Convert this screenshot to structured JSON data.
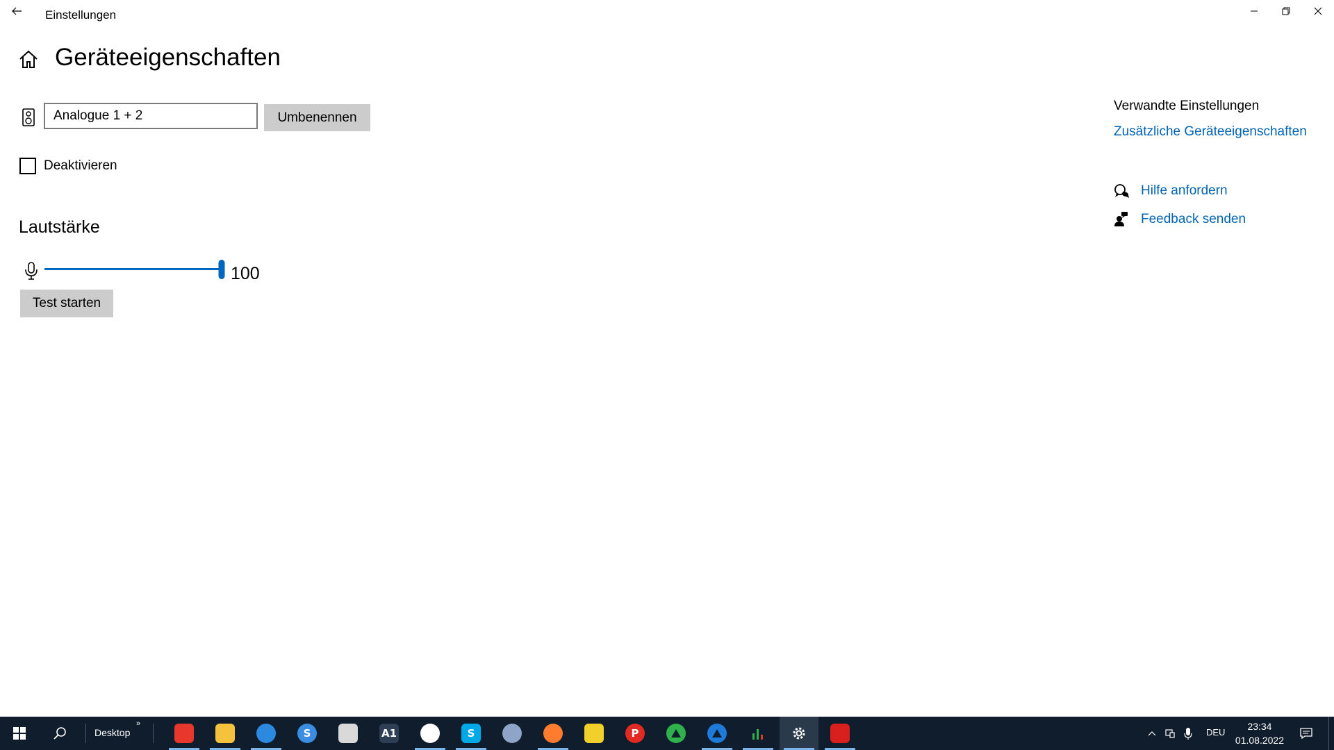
{
  "window": {
    "title": "Einstellungen",
    "back_icon": "back-arrow-icon",
    "controls": [
      "minimize-icon",
      "restore-icon",
      "close-icon"
    ]
  },
  "page": {
    "title": "Geräteeigenschaften",
    "home_icon": "home-icon"
  },
  "device": {
    "icon": "speaker-icon",
    "name_value": "Analogue 1 + 2",
    "rename_label": "Umbenennen",
    "disable_label": "Deaktivieren",
    "disable_checked": false
  },
  "volume": {
    "heading": "Lautstärke",
    "icon": "microphone-icon",
    "level": 100,
    "value_text": "100",
    "test_label": "Test starten",
    "accent_color": "#0067c0"
  },
  "related": {
    "heading": "Verwandte Einstellungen",
    "link": "Zusätzliche Geräteeigenschaften",
    "help_label": "Hilfe anfordern",
    "help_icon": "help-chat-icon",
    "feedback_label": "Feedback senden",
    "feedback_icon": "feedback-person-icon",
    "link_color": "#0063b1"
  },
  "taskbar": {
    "start_icon": "windows-start-icon",
    "search_icon": "search-icon",
    "desktop_label": "Desktop",
    "apps": [
      {
        "name": "brave-icon",
        "color": "#e8382d"
      },
      {
        "name": "file-explorer-icon",
        "color": "#f5c23e"
      },
      {
        "name": "swift-browser-icon",
        "color": "#2b89e0"
      },
      {
        "name": "simplenote-icon",
        "color": "#3a8de0"
      },
      {
        "name": "piano-app-icon",
        "color": "#d9d9d9"
      },
      {
        "name": "a1-app-icon",
        "color": "#2d3e55"
      },
      {
        "name": "circle-slash-app-icon",
        "color": "#ffffff"
      },
      {
        "name": "skype-icon",
        "color": "#00a8e8"
      },
      {
        "name": "eye-app-icon",
        "color": "#8fa5c8"
      },
      {
        "name": "firefox-icon",
        "color": "#ff7b2d"
      },
      {
        "name": "feather-app-icon",
        "color": "#f2d02b"
      },
      {
        "name": "red-tool-icon",
        "color": "#e02a22"
      },
      {
        "name": "green-triangle-icon",
        "color": "#2fb24b"
      },
      {
        "name": "blue-triangle-icon",
        "color": "#1f7bd9"
      },
      {
        "name": "bar-graph-icon",
        "color": "#2fb24b"
      },
      {
        "name": "settings-gear-icon",
        "color": "#ffffff"
      },
      {
        "name": "red-flower-icon",
        "color": "#d9201e"
      }
    ],
    "language": "DEU",
    "time": "23:34",
    "date": "01.08.2022"
  }
}
